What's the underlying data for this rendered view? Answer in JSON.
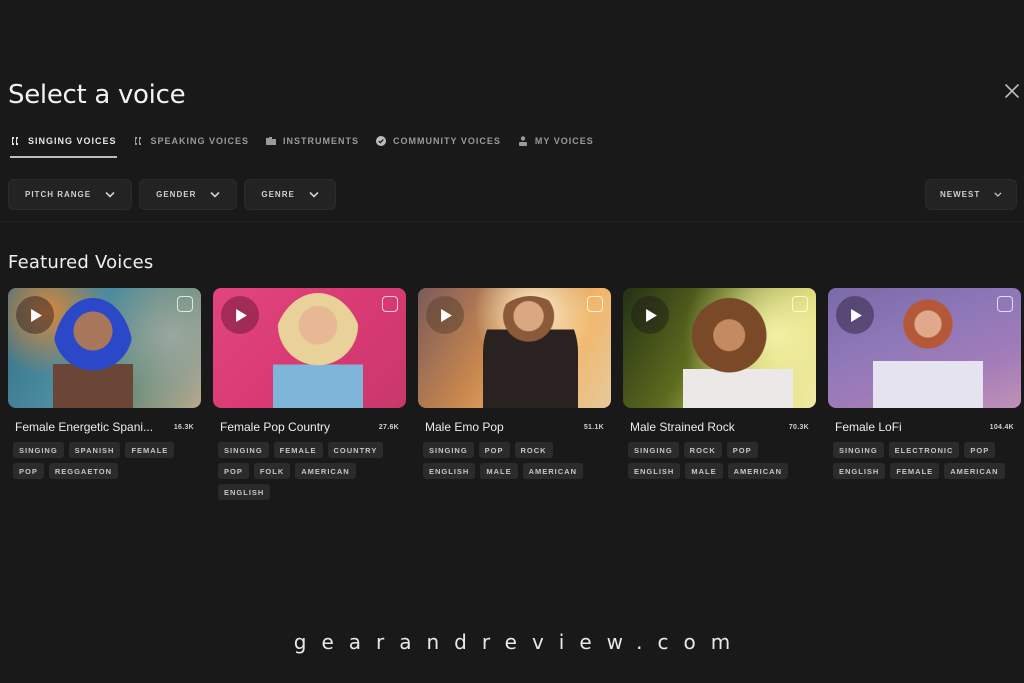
{
  "header": {
    "title": "Select a voice",
    "close_icon": "close-icon"
  },
  "tabs": [
    {
      "label": "SINGING VOICES",
      "icon": "singing-voices-icon",
      "active": true
    },
    {
      "label": "SPEAKING VOICES",
      "icon": "speaking-voices-icon",
      "active": false
    },
    {
      "label": "INSTRUMENTS",
      "icon": "piano-icon",
      "active": false
    },
    {
      "label": "COMMUNITY VOICES",
      "icon": "verified-badge-icon",
      "active": false
    },
    {
      "label": "MY VOICES",
      "icon": "user-icon",
      "active": false
    }
  ],
  "filters": [
    {
      "label": "PITCH RANGE"
    },
    {
      "label": "GENDER"
    },
    {
      "label": "GENRE"
    }
  ],
  "sort": {
    "label": "NEWEST"
  },
  "featured": {
    "title": "Featured Voices",
    "voices": [
      {
        "name": "Female Energetic Spani...",
        "count": "16.3K",
        "tags": [
          "SINGING",
          "SPANISH",
          "FEMALE",
          "POP",
          "REGGAETON"
        ]
      },
      {
        "name": "Female Pop Country",
        "count": "27.6K",
        "tags": [
          "SINGING",
          "FEMALE",
          "COUNTRY",
          "POP",
          "FOLK",
          "AMERICAN",
          "ENGLISH"
        ]
      },
      {
        "name": "Male Emo Pop",
        "count": "51.1K",
        "tags": [
          "SINGING",
          "POP",
          "ROCK",
          "ENGLISH",
          "MALE",
          "AMERICAN"
        ]
      },
      {
        "name": "Male Strained Rock",
        "count": "70.3K",
        "tags": [
          "SINGING",
          "ROCK",
          "POP",
          "ENGLISH",
          "MALE",
          "AMERICAN"
        ]
      },
      {
        "name": "Female LoFi",
        "count": "104.4K",
        "tags": [
          "SINGING",
          "ELECTRONIC",
          "POP",
          "ENGLISH",
          "FEMALE",
          "AMERICAN"
        ]
      }
    ]
  },
  "watermark": "gearandreview.com",
  "colors": {
    "background": "#191919",
    "control": "#232323",
    "tag": "#2b2b2b",
    "text": "#e8e8e8"
  }
}
